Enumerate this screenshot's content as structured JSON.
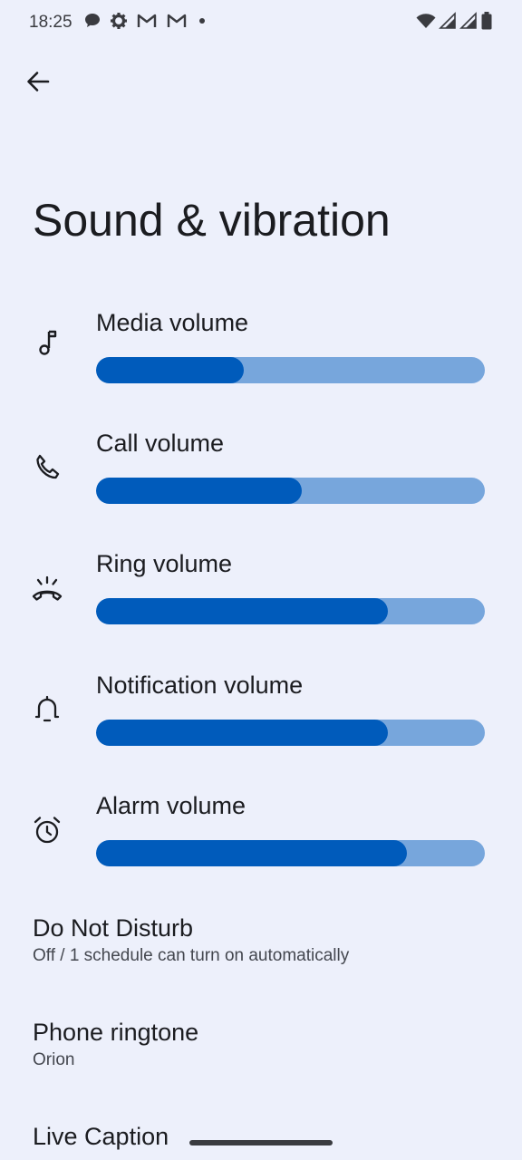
{
  "status_bar": {
    "time": "18:25",
    "left_icons": [
      "chat-bubble-icon",
      "gear-icon",
      "gmail-icon",
      "gmail-icon",
      "dot-icon"
    ],
    "right_icons": [
      "wifi-icon",
      "signal-icon",
      "signal-icon",
      "battery-icon"
    ]
  },
  "header": {
    "back_icon": "arrow-back-icon",
    "title": "Sound & vibration"
  },
  "volumes": [
    {
      "icon": "music-note-icon",
      "label": "Media volume",
      "level": 0.38
    },
    {
      "icon": "phone-icon",
      "label": "Call volume",
      "level": 0.53
    },
    {
      "icon": "ring-icon",
      "label": "Ring volume",
      "level": 0.75
    },
    {
      "icon": "bell-icon",
      "label": "Notification volume",
      "level": 0.75
    },
    {
      "icon": "alarm-icon",
      "label": "Alarm volume",
      "level": 0.8
    }
  ],
  "settings": [
    {
      "title": "Do Not Disturb",
      "summary": "Off / 1 schedule can turn on automatically"
    },
    {
      "title": "Phone ringtone",
      "summary": "Orion"
    },
    {
      "title": "Live Caption",
      "summary": ""
    }
  ],
  "colors": {
    "background": "#edf0fb",
    "slider_active": "#005bbb",
    "slider_inactive": "#77a6dc"
  }
}
